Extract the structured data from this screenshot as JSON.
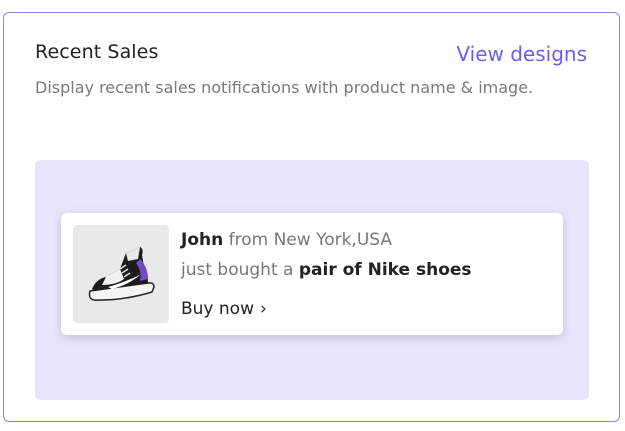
{
  "card": {
    "title": "Recent Sales",
    "view_link": "View designs",
    "description": "Display recent sales notifications with product name & image."
  },
  "notification": {
    "customer": "John",
    "location_text": "from New York,USA",
    "action_text": "just bought a",
    "product": "pair of Nike shoes",
    "cta": "Buy now",
    "cta_icon": "chevron-right-icon",
    "image_icon": "sneaker-image"
  },
  "colors": {
    "accent": "#6a5ff0",
    "card_border": "#8b85e8",
    "preview_bg": "#e7e6fd"
  }
}
